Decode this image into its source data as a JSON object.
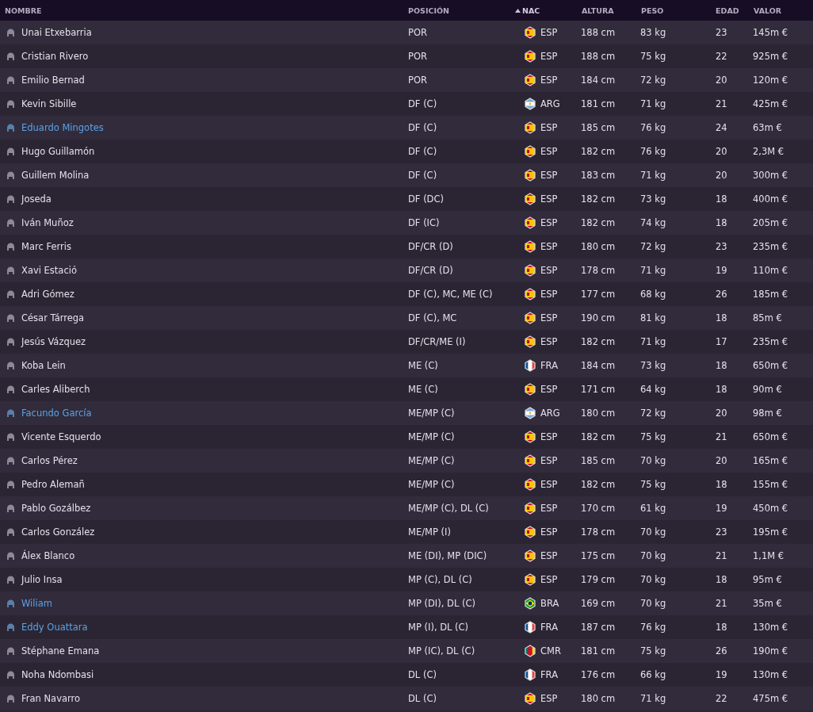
{
  "table": {
    "columns": [
      {
        "label": "NOMBRE",
        "sorted": false
      },
      {
        "label": "POSICIÓN",
        "sorted": false
      },
      {
        "label": "NAC",
        "sorted": true
      },
      {
        "label": "ALTURA",
        "sorted": false
      },
      {
        "label": "PESO",
        "sorted": false
      },
      {
        "label": "EDAD",
        "sorted": false
      },
      {
        "label": "VALOR",
        "sorted": false
      }
    ],
    "rows": [
      {
        "name": "Unai Etxebarria",
        "highlighted": false,
        "position": "POR",
        "kind": "spain",
        "nation": "ESP",
        "height": "188 cm",
        "weight": "83 kg",
        "age": "23",
        "value": "145m €"
      },
      {
        "name": "Cristian Rivero",
        "highlighted": false,
        "position": "POR",
        "kind": "spain",
        "nation": "ESP",
        "height": "188 cm",
        "weight": "75 kg",
        "age": "22",
        "value": "925m €"
      },
      {
        "name": "Emilio Bernad",
        "highlighted": false,
        "position": "POR",
        "kind": "spain",
        "nation": "ESP",
        "height": "184 cm",
        "weight": "72 kg",
        "age": "20",
        "value": "120m €"
      },
      {
        "name": "Kevin Sibille",
        "highlighted": false,
        "position": "DF (C)",
        "kind": "argentina",
        "nation": "ARG",
        "height": "181 cm",
        "weight": "71 kg",
        "age": "21",
        "value": "425m €"
      },
      {
        "name": "Eduardo Mingotes",
        "highlighted": true,
        "position": "DF (C)",
        "kind": "spain",
        "nation": "ESP",
        "height": "185 cm",
        "weight": "76 kg",
        "age": "24",
        "value": "63m €"
      },
      {
        "name": "Hugo Guillamón",
        "highlighted": false,
        "position": "DF (C)",
        "kind": "spain",
        "nation": "ESP",
        "height": "182 cm",
        "weight": "76 kg",
        "age": "20",
        "value": "2,3M €"
      },
      {
        "name": "Guillem Molina",
        "highlighted": false,
        "position": "DF (C)",
        "kind": "spain",
        "nation": "ESP",
        "height": "183 cm",
        "weight": "71 kg",
        "age": "20",
        "value": "300m €"
      },
      {
        "name": "Joseda",
        "highlighted": false,
        "position": "DF (DC)",
        "kind": "spain",
        "nation": "ESP",
        "height": "182 cm",
        "weight": "73 kg",
        "age": "18",
        "value": "400m €"
      },
      {
        "name": "Iván Muñoz",
        "highlighted": false,
        "position": "DF (IC)",
        "kind": "spain",
        "nation": "ESP",
        "height": "182 cm",
        "weight": "74 kg",
        "age": "18",
        "value": "205m €"
      },
      {
        "name": "Marc Ferris",
        "highlighted": false,
        "position": "DF/CR (D)",
        "kind": "spain",
        "nation": "ESP",
        "height": "180 cm",
        "weight": "72 kg",
        "age": "23",
        "value": "235m €"
      },
      {
        "name": "Xavi Estació",
        "highlighted": false,
        "position": "DF/CR (D)",
        "kind": "spain",
        "nation": "ESP",
        "height": "178 cm",
        "weight": "71 kg",
        "age": "19",
        "value": "110m €"
      },
      {
        "name": "Adri Gómez",
        "highlighted": false,
        "position": "DF (C), MC, ME (C)",
        "kind": "spain",
        "nation": "ESP",
        "height": "177 cm",
        "weight": "68 kg",
        "age": "26",
        "value": "185m €"
      },
      {
        "name": "César Tárrega",
        "highlighted": false,
        "position": "DF (C), MC",
        "kind": "spain",
        "nation": "ESP",
        "height": "190 cm",
        "weight": "81 kg",
        "age": "18",
        "value": "85m €"
      },
      {
        "name": "Jesús Vázquez",
        "highlighted": false,
        "position": "DF/CR/ME (I)",
        "kind": "spain",
        "nation": "ESP",
        "height": "182 cm",
        "weight": "71 kg",
        "age": "17",
        "value": "235m €"
      },
      {
        "name": "Koba Lein",
        "highlighted": false,
        "position": "ME (C)",
        "kind": "france",
        "nation": "FRA",
        "height": "184 cm",
        "weight": "73 kg",
        "age": "18",
        "value": "650m €"
      },
      {
        "name": "Carles Aliberch",
        "highlighted": false,
        "position": "ME (C)",
        "kind": "spain",
        "nation": "ESP",
        "height": "171 cm",
        "weight": "64 kg",
        "age": "18",
        "value": "90m €"
      },
      {
        "name": "Facundo García",
        "highlighted": true,
        "position": "ME/MP (C)",
        "kind": "argentina",
        "nation": "ARG",
        "height": "180 cm",
        "weight": "72 kg",
        "age": "20",
        "value": "98m €"
      },
      {
        "name": "Vicente Esquerdo",
        "highlighted": false,
        "position": "ME/MP (C)",
        "kind": "spain",
        "nation": "ESP",
        "height": "182 cm",
        "weight": "75 kg",
        "age": "21",
        "value": "650m €"
      },
      {
        "name": "Carlos Pérez",
        "highlighted": false,
        "position": "ME/MP (C)",
        "kind": "spain",
        "nation": "ESP",
        "height": "185 cm",
        "weight": "70 kg",
        "age": "20",
        "value": "165m €"
      },
      {
        "name": "Pedro Alemañ",
        "highlighted": false,
        "position": "ME/MP (C)",
        "kind": "spain",
        "nation": "ESP",
        "height": "182 cm",
        "weight": "75 kg",
        "age": "18",
        "value": "155m €"
      },
      {
        "name": "Pablo Gozálbez",
        "highlighted": false,
        "position": "ME/MP (C), DL (C)",
        "kind": "spain",
        "nation": "ESP",
        "height": "170 cm",
        "weight": "61 kg",
        "age": "19",
        "value": "450m €"
      },
      {
        "name": "Carlos González",
        "highlighted": false,
        "position": "ME/MP (I)",
        "kind": "spain",
        "nation": "ESP",
        "height": "178 cm",
        "weight": "70 kg",
        "age": "23",
        "value": "195m €"
      },
      {
        "name": "Álex Blanco",
        "highlighted": false,
        "position": "ME (DI), MP (DIC)",
        "kind": "spain",
        "nation": "ESP",
        "height": "175 cm",
        "weight": "70 kg",
        "age": "21",
        "value": "1,1M €"
      },
      {
        "name": "Julio Insa",
        "highlighted": false,
        "position": "MP (C), DL (C)",
        "kind": "spain",
        "nation": "ESP",
        "height": "179 cm",
        "weight": "70 kg",
        "age": "18",
        "value": "95m €"
      },
      {
        "name": "Wiliam",
        "highlighted": true,
        "position": "MP (DI), DL (C)",
        "kind": "brazil",
        "nation": "BRA",
        "height": "169 cm",
        "weight": "70 kg",
        "age": "21",
        "value": "35m €"
      },
      {
        "name": "Eddy Ouattara",
        "highlighted": true,
        "position": "MP (I), DL (C)",
        "kind": "france",
        "nation": "FRA",
        "height": "187 cm",
        "weight": "76 kg",
        "age": "18",
        "value": "130m €"
      },
      {
        "name": "Stéphane Emana",
        "highlighted": false,
        "position": "MP (IC), DL (C)",
        "kind": "cameroon",
        "nation": "CMR",
        "height": "181 cm",
        "weight": "75 kg",
        "age": "26",
        "value": "190m €"
      },
      {
        "name": "Noha Ndombasi",
        "highlighted": false,
        "position": "DL (C)",
        "kind": "france",
        "nation": "FRA",
        "height": "176 cm",
        "weight": "66 kg",
        "age": "19",
        "value": "130m €"
      },
      {
        "name": "Fran Navarro",
        "highlighted": false,
        "position": "DL (C)",
        "kind": "spain",
        "nation": "ESP",
        "height": "180 cm",
        "weight": "71 kg",
        "age": "22",
        "value": "475m €"
      }
    ]
  }
}
